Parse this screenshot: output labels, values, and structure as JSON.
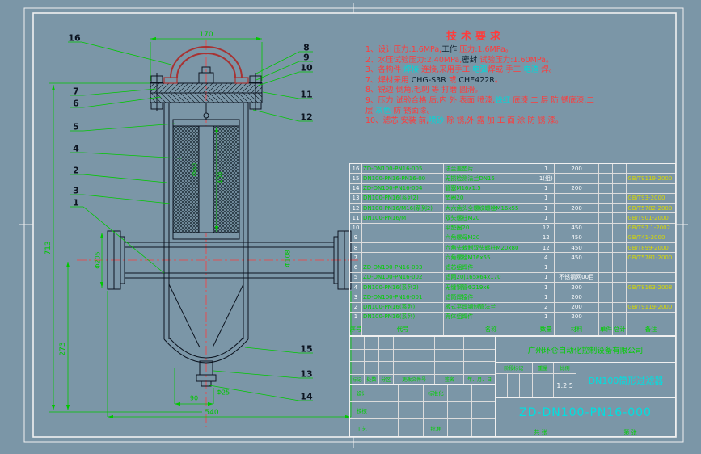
{
  "palette": {
    "r": "#ff3b3b",
    "c": "#00d8d8",
    "k": "#0e1e2a",
    "g": "#00c800",
    "w": "#ffffff",
    "y": "#d8d800"
  },
  "sheet": {
    "bg": "#7b96a7",
    "frame": "#ffffff",
    "line": "#0c1420",
    "dim": "#00c800",
    "center": "#ff3b3b",
    "handle": "#a83232"
  },
  "tech_requirements": {
    "title": "技术要求",
    "lines": [
      [
        {
          "t": "1、设计压力:1.6MPa,",
          "c": "r"
        },
        {
          "t": "工作",
          "c": "k"
        },
        {
          "t": " 压力:1.6MPa。",
          "c": "r"
        }
      ],
      [
        {
          "t": "2、水压试验压力:2.40MPa,",
          "c": "r"
        },
        {
          "t": "密封",
          "c": "k"
        },
        {
          "t": " 试验压力:1.60MPa。",
          "c": "r"
        }
      ],
      [
        {
          "t": "3、各构件 ",
          "c": "r"
        },
        {
          "t": "焊接",
          "c": "c"
        },
        {
          "t": " 连接,采用手工 ",
          "c": "r"
        },
        {
          "t": "电弧",
          "c": "c"
        },
        {
          "t": "焊或 手工 ",
          "c": "r"
        },
        {
          "t": "电渣",
          "c": "c"
        },
        {
          "t": " 焊。",
          "c": "r"
        }
      ],
      [
        {
          "t": "7、焊材采用 ",
          "c": "r"
        },
        {
          "t": "CHG-S3R",
          "c": "k"
        },
        {
          "t": " 或  ",
          "c": "r"
        },
        {
          "t": "CHE422R",
          "c": "k"
        },
        {
          "t": "。",
          "c": "r"
        }
      ],
      [
        {
          "t": "8、锐边 倒角,毛刺 等 打磨 圆滑。",
          "c": "r"
        }
      ],
      [
        {
          "t": "9、压力 试验合格 后,内 外 表面 喷漆,",
          "c": "r"
        },
        {
          "t": "铁红",
          "c": "c"
        },
        {
          "t": " 底漆 二 层 防 锈底漆,二",
          "c": "r"
        }
      ],
      [
        {
          "t": "层 ",
          "c": "r"
        },
        {
          "t": "灰色",
          "c": "c"
        },
        {
          "t": " 防 锈面漆。",
          "c": "r"
        }
      ],
      [
        {
          "t": "10、滤芯 安装 前,",
          "c": "r"
        },
        {
          "t": "喷砂",
          "c": "c"
        },
        {
          "t": " 除 锈,外 露 加 工 面 涂 防 锈 漆。",
          "c": "r"
        }
      ]
    ]
  },
  "dimensions": {
    "top_width": "170",
    "overall_height": "713",
    "lower_height": "273",
    "overall_width": "540",
    "drain_height": "90",
    "drain_size": "Φ25",
    "core_dia": "Φ60",
    "filter_height": "400",
    "pipe_dia": "Φ108",
    "flange_dia": "Φ205"
  },
  "balloons": {
    "b1": "1",
    "b2": "2",
    "b3": "3",
    "b4": "4",
    "b5": "5",
    "b6": "6",
    "b7": "7",
    "b8": "8",
    "b9": "9",
    "b10": "10",
    "b11": "11",
    "b12": "12",
    "b13": "13",
    "b14": "14",
    "b15": "15",
    "b16": "16"
  },
  "bom": {
    "headers": [
      "序号",
      "代号",
      "名称",
      "数量",
      "材料",
      "单件",
      "总计",
      "备注"
    ],
    "rows": [
      [
        "16",
        "ZD-DN100-PN16-005",
        "法兰盖垫片",
        "1",
        "200",
        "",
        "",
        ""
      ],
      [
        "15",
        "DN100-PN16-PN16-00",
        "无损检测法兰DN15",
        "1(组)",
        "",
        "",
        "",
        "GB/T9119-2000"
      ],
      [
        "14",
        "ZD-DN100-PN16-004",
        "管塞M16x1.5",
        "1",
        "200",
        "",
        "",
        ""
      ],
      [
        "13",
        "DN100-PN16(系列2)",
        "垫圈20",
        "1",
        "",
        "",
        "",
        "GB/T93-2000"
      ],
      [
        "12",
        "DN100-PN16/M16(系列2)",
        "大六角头全螺纹螺栓M16x55",
        "1",
        "200",
        "",
        "",
        "GB/T5782-2000"
      ],
      [
        "11",
        "DN100-PN16/M",
        "双头螺柱M20",
        "1",
        "",
        "",
        "",
        "GB/T901-2000"
      ],
      [
        "10",
        "",
        "平垫圈20",
        "12",
        "450",
        "",
        "",
        "GB/T97.1-2002"
      ],
      [
        "9",
        "",
        "六角螺母M20",
        "12",
        "450",
        "",
        "",
        "GB/T41-2000"
      ],
      [
        "8",
        "",
        "六角头栽制双头螺柱M20x80",
        "12",
        "450",
        "",
        "",
        "GB/T899-2000"
      ],
      [
        "7",
        "",
        "六角螺栓M16x55",
        "4",
        "450",
        "",
        "",
        "GB/T5781-2000"
      ],
      [
        "6",
        "ZD-DN100-PN16-003",
        "滤芯组焊件",
        "1",
        "",
        "",
        "",
        ""
      ],
      [
        "5",
        "ZD-DN100-PN16-002",
        "滤网20|165x64x170",
        "1",
        "不锈钢网00目",
        "",
        "",
        ""
      ],
      [
        "4",
        "DN100-PN16(系列2)",
        "无缝钢管Φ219x6",
        "1",
        "200",
        "",
        "",
        "GB/T8163-2008"
      ],
      [
        "3",
        "ZD-DN100-PN16-001",
        "滤筒焊接件",
        "1",
        "200",
        "",
        "",
        ""
      ],
      [
        "2",
        "DN100-PN16(系列)",
        "板式平焊钢制管法兰",
        "2",
        "200",
        "",
        "",
        "GB/T9119-2000"
      ],
      [
        "1",
        "DN100-PN16(系列)",
        "壳体组焊件",
        "1",
        "200",
        "",
        "",
        ""
      ]
    ]
  },
  "title_block": {
    "company": "广州环仑自动化控制设备有限公司",
    "product": "DN100筒形过滤器",
    "drawing_no": "ZD-DN100-PN16-000",
    "scale_value": "1:2.5",
    "labels": {
      "mark": "标记",
      "count": "处数",
      "zone": "分区",
      "change_doc": "更改文件号",
      "sign": "签名",
      "date": "年、月、日",
      "design": "设计",
      "check": "校核",
      "process": "工艺",
      "approve": "批准",
      "standard": "标准化",
      "stage": "阶段标记",
      "weight": "重量",
      "scale": "比例",
      "sheet_total": "共  张",
      "sheet_no": "第  张"
    }
  }
}
